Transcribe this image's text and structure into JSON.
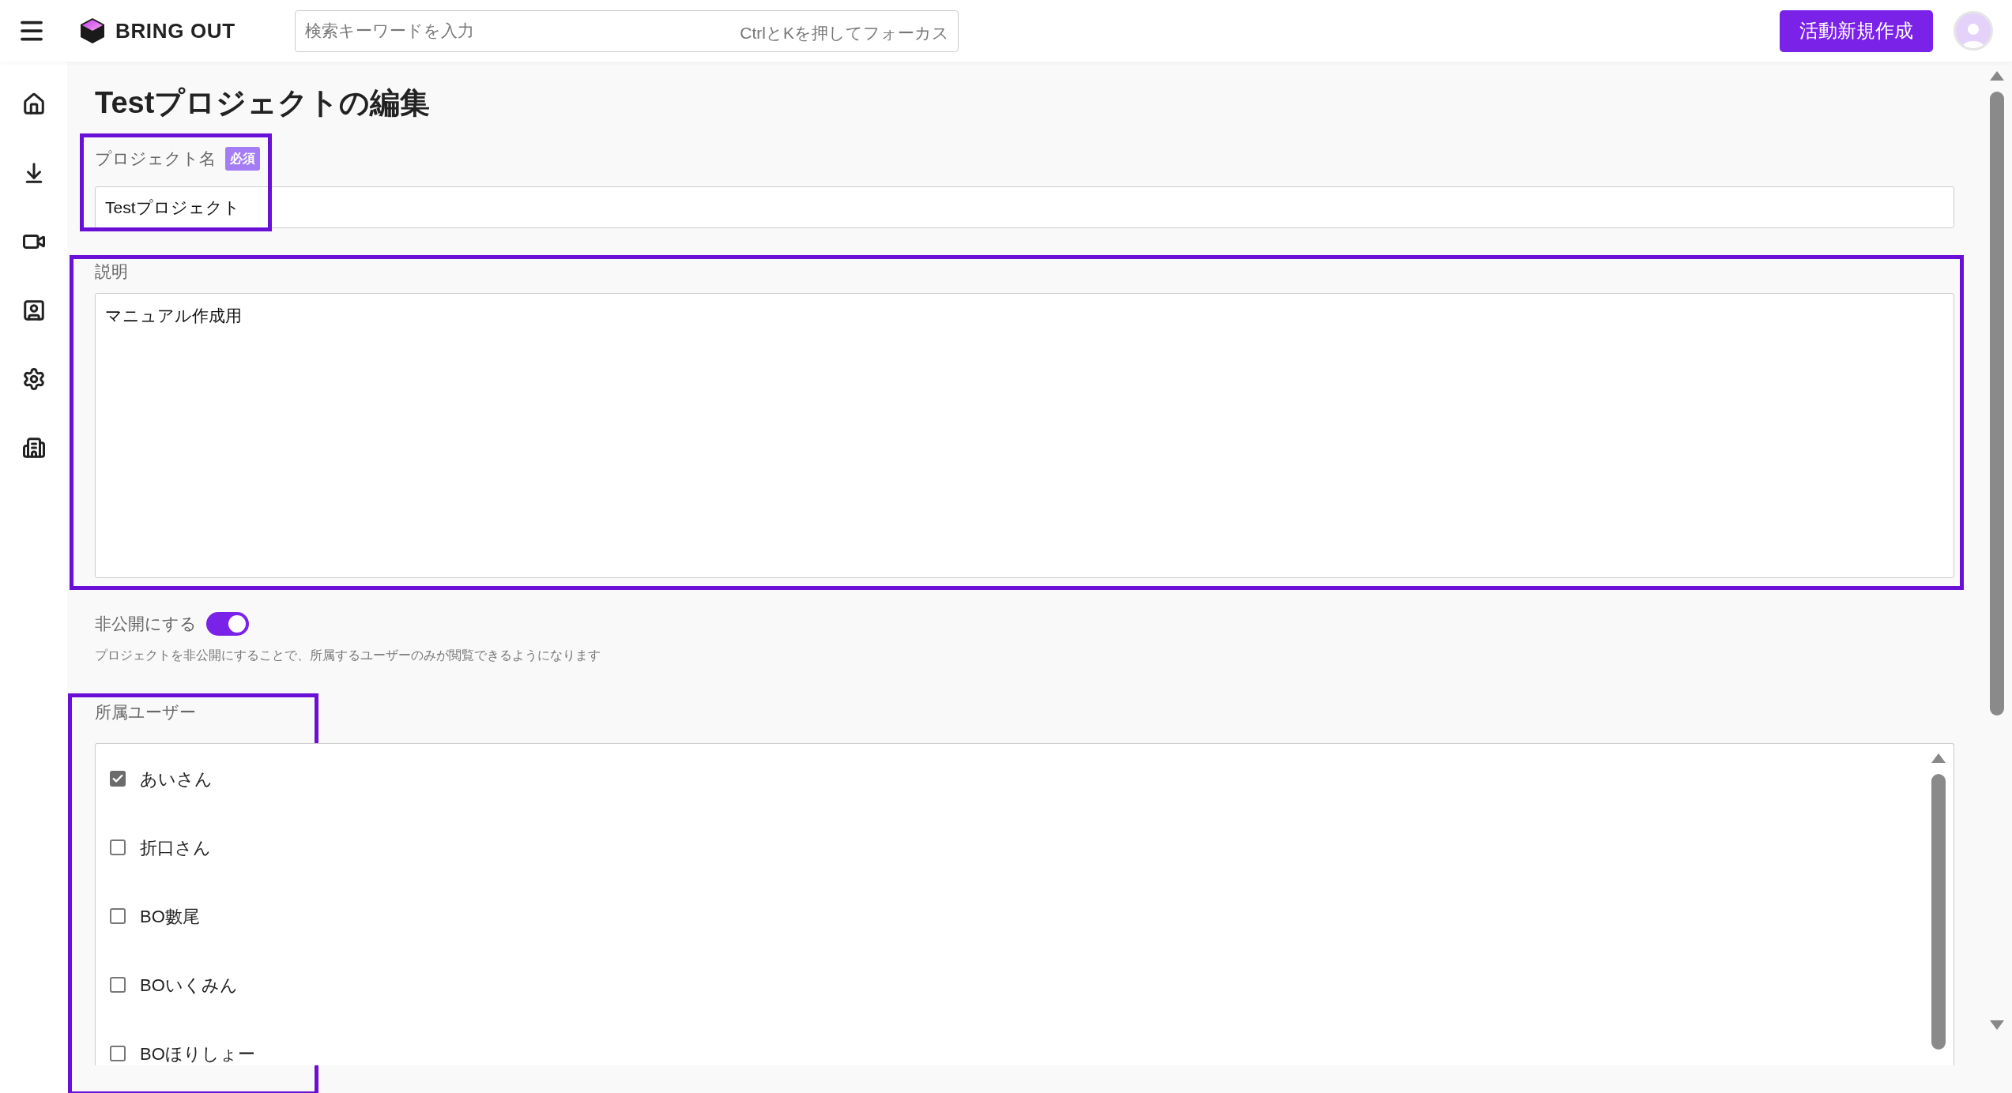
{
  "brand": "BRING OUT",
  "search": {
    "placeholder": "検索キーワードを入力",
    "shortcut_hint": "CtrlとKを押してフォーカス"
  },
  "create_button": "活動新規作成",
  "page_title": "Testプロジェクトの編集",
  "name_field": {
    "label": "プロジェクト名",
    "required_badge": "必須",
    "value": "Testプロジェクト",
    "highlighted": true
  },
  "description_field": {
    "label": "説明",
    "value": "マニュアル作成用",
    "highlighted": true
  },
  "private_toggle": {
    "label": "非公開にする",
    "on": true,
    "help": "プロジェクトを非公開にすることで、所属するユーザーのみが閲覧できるようになります"
  },
  "members": {
    "label": "所属ユーザー",
    "highlighted": true,
    "users": [
      {
        "name": "あいさん",
        "checked": true
      },
      {
        "name": "折口さん",
        "checked": false
      },
      {
        "name": "BO數尾",
        "checked": false
      },
      {
        "name": "BOいくみん",
        "checked": false
      },
      {
        "name": "BOほりしょー",
        "checked": false
      }
    ]
  }
}
